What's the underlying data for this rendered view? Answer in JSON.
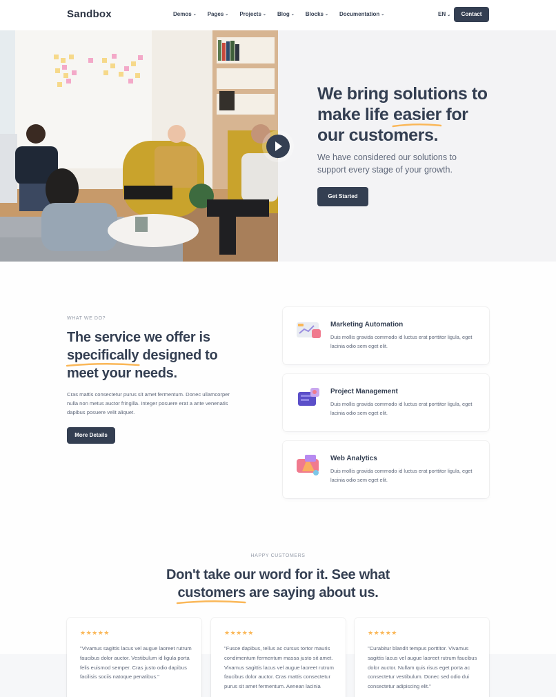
{
  "nav": {
    "logo": "Sandbox",
    "items": [
      {
        "label": "Demos"
      },
      {
        "label": "Pages"
      },
      {
        "label": "Projects"
      },
      {
        "label": "Blog"
      },
      {
        "label": "Blocks"
      },
      {
        "label": "Documentation"
      }
    ],
    "lang": "EN",
    "contact": "Contact"
  },
  "hero": {
    "title_1": "We bring solutions to",
    "title_2a": "make life ",
    "title_2b": "easier",
    "title_2c": " for",
    "title_3": "our customers.",
    "subtitle": "We have considered our solutions to support every stage of your growth.",
    "cta": "Get Started",
    "play_icon": "play-icon"
  },
  "services": {
    "eyebrow": "WHAT WE DO?",
    "title_1": "The service we offer is",
    "title_2a": "specifically",
    "title_2b": " designed to",
    "title_3": "meet your needs.",
    "text": "Cras mattis consectetur purus sit amet fermentum. Donec ullamcorper nulla non metus auctor fringilla. Integer posuere erat a ante venenatis dapibus posuere velit aliquet.",
    "cta": "More Details",
    "cards": [
      {
        "title": "Marketing Automation",
        "text": "Duis mollis gravida commodo id luctus erat porttitor ligula, eget lacinia odio sem eget elit.",
        "icon": "marketing-icon"
      },
      {
        "title": "Project Management",
        "text": "Duis mollis gravida commodo id luctus erat porttitor ligula, eget lacinia odio sem eget elit.",
        "icon": "project-icon"
      },
      {
        "title": "Web Analytics",
        "text": "Duis mollis gravida commodo id luctus erat porttitor ligula, eget lacinia odio sem eget elit.",
        "icon": "analytics-icon"
      }
    ]
  },
  "testimonials": {
    "eyebrow": "HAPPY CUSTOMERS",
    "title_1": "Don't take our word for it. See what",
    "title_2a": "customers",
    "title_2b": " are saying about us.",
    "items": [
      {
        "stars": "★★★★★",
        "quote": "\"Vivamus sagittis lacus vel augue laoreet rutrum faucibus dolor auctor. Vestibulum id ligula porta felis euismod semper. Cras justo odio dapibus facilisis sociis natoque penatibus.\""
      },
      {
        "stars": "★★★★★",
        "quote": "\"Fusce dapibus, tellus ac cursus tortor mauris condimentum fermentum massa justo sit amet. Vivamus sagittis lacus vel augue laoreet rutrum faucibus dolor auctor. Cras mattis consectetur purus sit amet fermentum. Aenean lacinia"
      },
      {
        "stars": "★★★★★",
        "quote": "\"Curabitur blandit tempus porttitor. Vivamus sagittis lacus vel augue laoreet rutrum faucibus dolor auctor. Nullam quis risus eget porta ac consectetur vestibulum. Donec sed odio dui consectetur adipiscing elit.\""
      }
    ]
  },
  "colors": {
    "primary": "#343f52",
    "accent": "#fab758",
    "muted": "#60697b"
  }
}
